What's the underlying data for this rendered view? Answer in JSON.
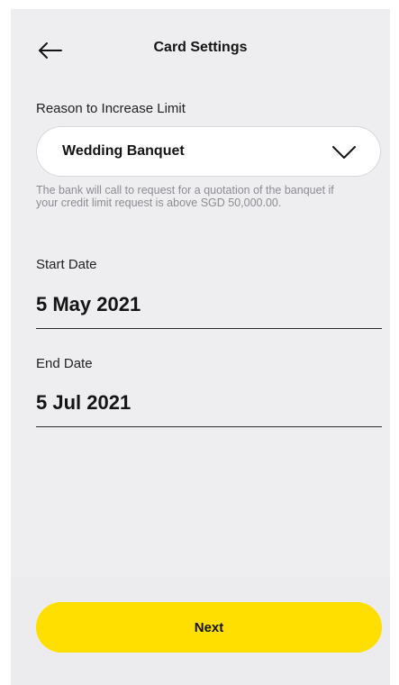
{
  "header": {
    "title": "Card Settings",
    "back_icon": "arrow-left-icon"
  },
  "reason": {
    "label": "Reason to Increase Limit",
    "selected_value": "Wedding Banquet",
    "dropdown_icon": "chevron-down-icon",
    "helper_text": "The bank will call to request for a quotation of the banquet if your credit limit request is above SGD 50,000.00."
  },
  "start_date": {
    "label": "Start Date",
    "value": "5 May 2021"
  },
  "end_date": {
    "label": "End Date",
    "value": "5 Jul 2021"
  },
  "footer": {
    "next_label": "Next"
  },
  "colors": {
    "screen_background": "#eeeef1",
    "primary_button": "#ffdf00",
    "text_primary": "#141414",
    "text_helper": "#8c8c92"
  }
}
